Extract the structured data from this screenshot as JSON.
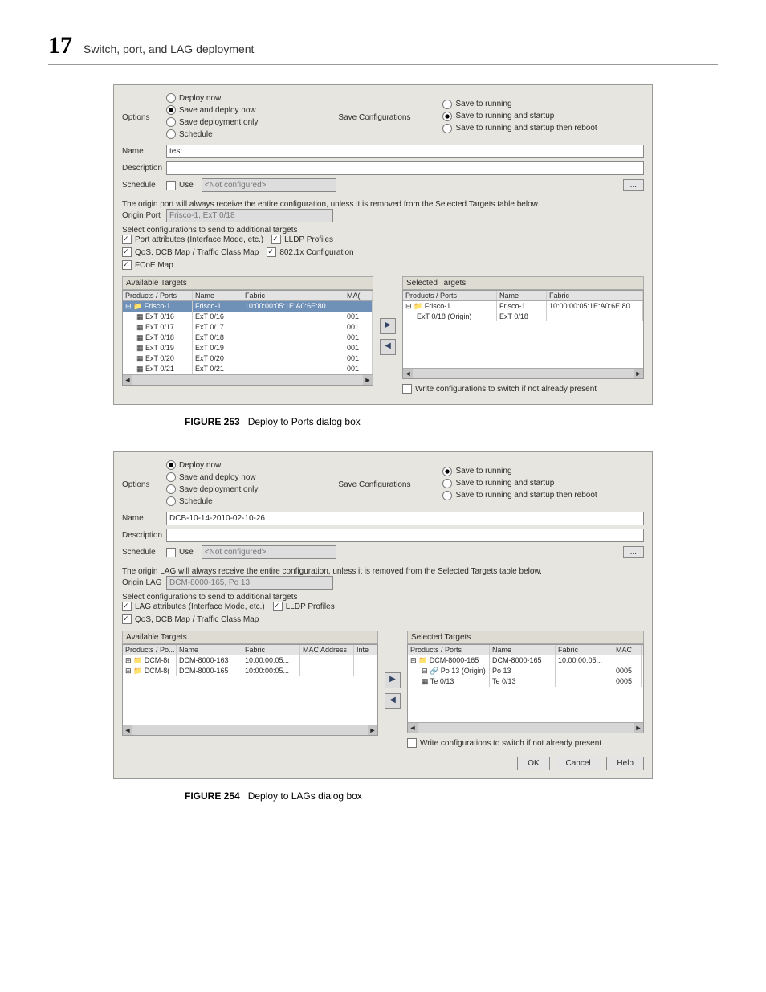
{
  "page": {
    "chapter_number": "17",
    "chapter_title": "Switch, port, and LAG deployment"
  },
  "figure253": {
    "caption_label": "FIGURE 253",
    "caption_text": "Deploy to Ports dialog box",
    "options_label": "Options",
    "opt_deploy_now": "Deploy now",
    "opt_save_deploy": "Save and deploy now",
    "opt_save_only": "Save deployment only",
    "opt_schedule": "Schedule",
    "save_conf_label": "Save Configurations",
    "save_running": "Save to running",
    "save_running_startup": "Save to running and startup",
    "save_running_startup_reboot": "Save to running and startup then reboot",
    "name_label": "Name",
    "name_value": "test",
    "desc_label": "Description",
    "schedule_label": "Schedule",
    "schedule_use": "Use",
    "schedule_value": "<Not configured>",
    "origin_note": "The origin port will always receive the entire configuration, unless it is removed from the Selected Targets table below.",
    "origin_port_label": "Origin Port",
    "origin_port_value": "Frisco-1, ExT 0/18",
    "select_conf": "Select configurations to send to additional targets",
    "chk_port_attr": "Port attributes (Interface Mode, etc.)",
    "chk_lldp": "LLDP Profiles",
    "chk_qos": "QoS, DCB Map / Traffic Class Map",
    "chk_8021x": "802.1x Configuration",
    "chk_fcoe": "FCoE Map",
    "available_label": "Available Targets",
    "selected_label": "Selected Targets",
    "col_products": "Products / Ports",
    "col_name": "Name",
    "col_fabric": "Fabric",
    "col_mac": "MA(",
    "col_name2": "Name",
    "col_fabric2": "Fabric",
    "avail_root": "Frisco-1",
    "avail_root_name": "Frisco-1",
    "avail_root_fabric": "10:00:00:05:1E:A0:6E:80",
    "avail_rows": [
      {
        "p": "ExT 0/16",
        "n": "ExT 0/16",
        "m": "001"
      },
      {
        "p": "ExT 0/17",
        "n": "ExT 0/17",
        "m": "001"
      },
      {
        "p": "ExT 0/18",
        "n": "ExT 0/18",
        "m": "001"
      },
      {
        "p": "ExT 0/19",
        "n": "ExT 0/19",
        "m": "001"
      },
      {
        "p": "ExT 0/20",
        "n": "ExT 0/20",
        "m": "001"
      },
      {
        "p": "ExT 0/21",
        "n": "ExT 0/21",
        "m": "001"
      }
    ],
    "sel_root": "Frisco-1",
    "sel_root_name": "Frisco-1",
    "sel_root_fabric": "10:00:00:05:1E:A0:6E:80",
    "sel_row_p": "ExT 0/18 (Origin)",
    "sel_row_n": "ExT 0/18",
    "write_conf": "Write configurations to switch if not already present"
  },
  "figure254": {
    "caption_label": "FIGURE 254",
    "caption_text": "Deploy to LAGs dialog box",
    "options_label": "Options",
    "opt_deploy_now": "Deploy now",
    "opt_save_deploy": "Save and deploy now",
    "opt_save_only": "Save deployment only",
    "opt_schedule": "Schedule",
    "save_conf_label": "Save Configurations",
    "save_running": "Save to running",
    "save_running_startup": "Save to running and startup",
    "save_running_startup_reboot": "Save to running and startup then reboot",
    "name_label": "Name",
    "name_value": "DCB-10-14-2010-02-10-26",
    "desc_label": "Description",
    "schedule_label": "Schedule",
    "schedule_use": "Use",
    "schedule_value": "<Not configured>",
    "origin_note": "The origin LAG will always receive the entire configuration, unless it is removed from the Selected Targets table below.",
    "origin_lag_label": "Origin LAG",
    "origin_lag_value": "DCM-8000-165, Po 13",
    "select_conf": "Select configurations to send to additional targets",
    "chk_lag_attr": "LAG attributes (Interface Mode, etc.)",
    "chk_lldp": "LLDP Profiles",
    "chk_qos": "QoS, DCB Map / Traffic Class Map",
    "available_label": "Available Targets",
    "selected_label": "Selected Targets",
    "col_products": "Products / Po...",
    "col_name": "Name",
    "col_fabric": "Fabric",
    "col_mac": "MAC Address",
    "col_inte": "Inte",
    "col_products2": "Products / Ports",
    "col_name2": "Name",
    "col_fabric2": "Fabric",
    "col_mac2": "MAC",
    "avail_rows": [
      {
        "p": "DCM-8(",
        "n": "DCM-8000-163",
        "f": "10:00:00:05..."
      },
      {
        "p": "DCM-8(",
        "n": "DCM-8000-165",
        "f": "10:00:00:05..."
      }
    ],
    "sel_root": "DCM-8000-165",
    "sel_root_name": "DCM-8000-165",
    "sel_root_fabric": "10:00:00:05...",
    "sel_rows": [
      {
        "p": "Po 13 (Origin)",
        "n": "Po 13",
        "m": "0005"
      },
      {
        "p": "Te 0/13",
        "n": "Te 0/13",
        "m": "0005"
      }
    ],
    "write_conf": "Write configurations to switch if not already present",
    "btn_ok": "OK",
    "btn_cancel": "Cancel",
    "btn_help": "Help"
  }
}
